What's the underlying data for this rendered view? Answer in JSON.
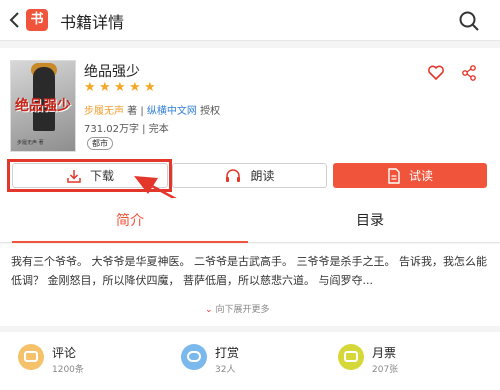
{
  "header": {
    "logo_char": "书",
    "title": "书籍详情"
  },
  "book": {
    "cover_title": "绝品强少",
    "cover_author": "步履无声 著",
    "title": "绝品强少",
    "rating_stars": 5,
    "author": "步履无声",
    "author_suffix": " 著 | ",
    "publisher": "纵横中文网",
    "license": " 授权",
    "word_count": "731.02万字 | 完本",
    "tag": "都市"
  },
  "actions": {
    "download_label": "下载",
    "read_aloud_label": "朗读",
    "trial_label": "试读"
  },
  "tabs": {
    "intro": "简介",
    "catalog": "目录"
  },
  "synopsis": {
    "text": "我有三个爷爷。 大爷爷是华夏神医。 二爷爷是古武高手。 三爷爷是杀手之王。 告诉我，我怎么能低调？ 金刚怒目，所以降伏四魔， 菩萨低眉，所以慈悲六道。 与阎罗夺...",
    "expand_label": "向下展开更多"
  },
  "stats": {
    "comment_label": "评论",
    "comment_count": "1200条",
    "reward_label": "打赏",
    "reward_count": "32人",
    "ticket_label": "月票",
    "ticket_count": "207张"
  },
  "colors": {
    "accent": "#f0543a",
    "annotation": "#e4372b",
    "star": "#f5a623",
    "author_link": "#f0a030",
    "publisher_link": "#2f7fd6"
  },
  "icons": [
    "back-icon",
    "app-logo",
    "search-icon",
    "heart-icon",
    "share-icon",
    "download-icon",
    "headphones-icon",
    "document-icon",
    "comment-icon",
    "reward-icon",
    "ticket-icon"
  ]
}
